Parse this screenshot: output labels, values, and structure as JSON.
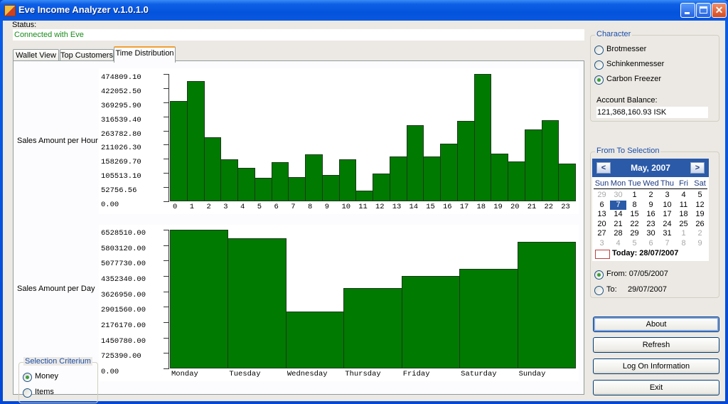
{
  "window": {
    "title": "Eve Income Analyzer v.1.0.1.0",
    "controls": [
      "minimize",
      "maximize",
      "close"
    ]
  },
  "status": {
    "label": "Status:",
    "value": "Connected with Eve",
    "value_color": "#1a8a1a"
  },
  "tabs": [
    {
      "label": "Wallet View",
      "active": false
    },
    {
      "label": "Top Customers",
      "active": false
    },
    {
      "label": "Time Distribution",
      "active": true
    }
  ],
  "charts": {
    "hour_label": "Sales Amount per Hour",
    "day_label": "Sales Amount per Day"
  },
  "chart_data": [
    {
      "type": "bar",
      "title": "Sales Amount per Hour",
      "xlabel": "",
      "ylabel": "Sales Amount per Hour",
      "categories": [
        "0",
        "1",
        "2",
        "3",
        "4",
        "5",
        "6",
        "7",
        "8",
        "9",
        "10",
        "11",
        "12",
        "13",
        "14",
        "15",
        "16",
        "17",
        "18",
        "19",
        "20",
        "21",
        "22",
        "23"
      ],
      "values": [
        373500,
        447500,
        237500,
        156600,
        124800,
        87800,
        146800,
        90500,
        174000,
        98400,
        156600,
        39100,
        104500,
        166100,
        282500,
        166100,
        215600,
        299400,
        474809,
        178500,
        149400,
        267700,
        302100,
        139700
      ],
      "yticks": [
        "0.00",
        "52756.56",
        "105513.10",
        "158269.70",
        "211026.30",
        "263782.80",
        "316539.40",
        "369295.90",
        "422052.50",
        "474809.10"
      ],
      "ylim": [
        0,
        474809.1
      ],
      "bar_color": "#007a00",
      "grid": false
    },
    {
      "type": "bar",
      "title": "Sales Amount per Day",
      "xlabel": "",
      "ylabel": "Sales Amount per Day",
      "categories": [
        "Monday",
        "Tuesday",
        "Wednesday",
        "Thursday",
        "Friday",
        "Saturday",
        "Sunday"
      ],
      "values": [
        6528510,
        6126000,
        2672000,
        3769000,
        4359000,
        4674000,
        5958000
      ],
      "yticks": [
        "0.00",
        "725390.00",
        "1450780.00",
        "2176170.00",
        "2901560.00",
        "3626950.00",
        "4352340.00",
        "5077730.00",
        "5803120.00",
        "6528510.00"
      ],
      "ylim": [
        0,
        6528510
      ],
      "bar_color": "#007a00",
      "grid": false
    }
  ],
  "selection_criterium": {
    "title": "Selection Criterium",
    "options": [
      {
        "label": "Money",
        "checked": true
      },
      {
        "label": "Items",
        "checked": false
      }
    ]
  },
  "character": {
    "title": "Character",
    "options": [
      {
        "label": "Brotmesser",
        "checked": false
      },
      {
        "label": "Schinkenmesser",
        "checked": false
      },
      {
        "label": "Carbon Freezer",
        "checked": true
      }
    ],
    "balance_label": "Account Balance:",
    "balance_value": "121,368,160.93 ISK"
  },
  "from_to": {
    "title": "From To Selection",
    "calendar": {
      "month_label": "May, 2007",
      "prev": "<",
      "next": ">",
      "weekdays": [
        "Sun",
        "Mon",
        "Tue",
        "Wed",
        "Thu",
        "Fri",
        "Sat"
      ],
      "weeks": [
        [
          "29",
          "30",
          "1",
          "2",
          "3",
          "4",
          "5"
        ],
        [
          "6",
          "7",
          "8",
          "9",
          "10",
          "11",
          "12"
        ],
        [
          "13",
          "14",
          "15",
          "16",
          "17",
          "18",
          "19"
        ],
        [
          "20",
          "21",
          "22",
          "23",
          "24",
          "25",
          "26"
        ],
        [
          "27",
          "28",
          "29",
          "30",
          "31",
          "1",
          "2"
        ],
        [
          "3",
          "4",
          "5",
          "6",
          "7",
          "8",
          "9"
        ]
      ],
      "selected_day": "7",
      "today_label": "Today: 28/07/2007"
    },
    "from_label": "From: 07/05/2007",
    "from_checked": true,
    "to_label": "To:     29/07/2007",
    "to_checked": false
  },
  "buttons": {
    "about": "About",
    "refresh": "Refresh",
    "logon": "Log On Information",
    "exit": "Exit"
  }
}
